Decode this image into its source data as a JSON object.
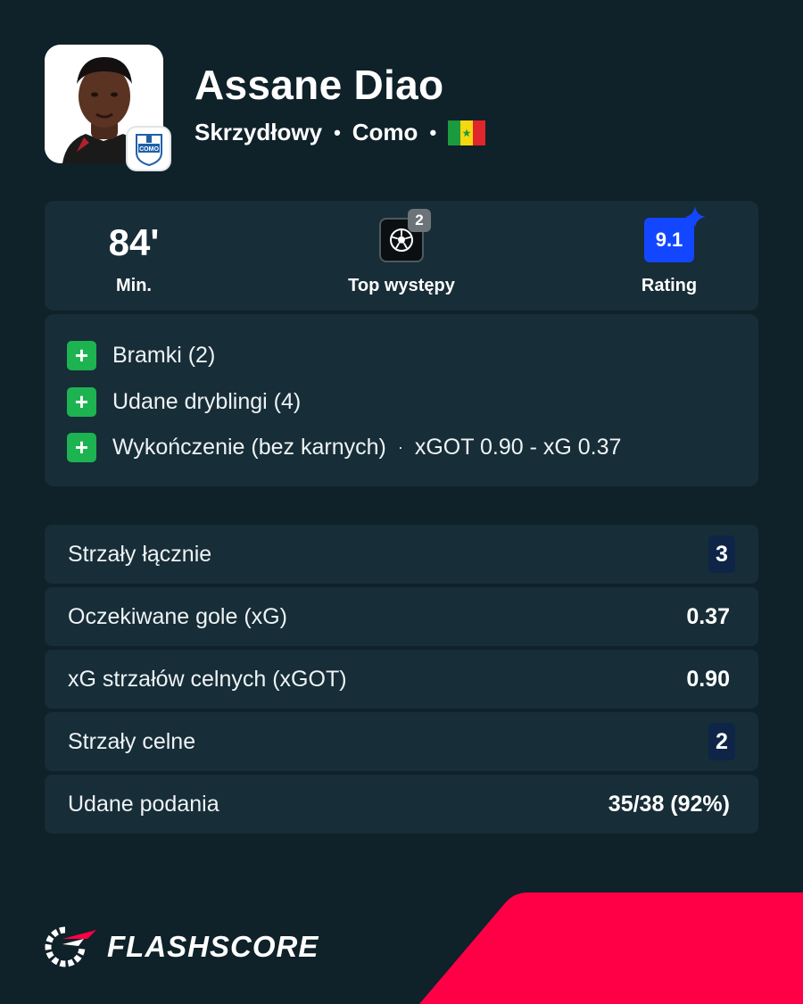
{
  "player": {
    "name": "Assane Diao",
    "position": "Skrzydłowy",
    "club": "Como",
    "club_badge_text": "COMO",
    "separator": "•"
  },
  "summary": {
    "minutes_value": "84'",
    "minutes_label": "Min.",
    "top_count": "2",
    "top_label": "Top występy",
    "rating_value": "9.1",
    "rating_label": "Rating"
  },
  "strengths": [
    {
      "icon": "+",
      "label": "Bramki (2)"
    },
    {
      "icon": "+",
      "label": "Udane dryblingi (4)"
    },
    {
      "icon": "+",
      "label": "Wykończenie (bez karnych)",
      "separator": "·",
      "detail": "xGOT 0.90 - xG 0.37"
    }
  ],
  "stats": [
    {
      "label": "Strzały łącznie",
      "value": "3"
    },
    {
      "label": "Oczekiwane gole (xG)",
      "value": "0.37"
    },
    {
      "label": "xG strzałów celnych (xGOT)",
      "value": "0.90"
    },
    {
      "label": "Strzały celne",
      "value": "2"
    },
    {
      "label": "Udane podania",
      "value": "35/38 (92%)"
    }
  ],
  "footer": {
    "brand": "FLASHSCORE"
  },
  "colors": {
    "background": "#0f2129",
    "card": "#172d37",
    "plus_green": "#1db351",
    "rating_blue": "#1347ff",
    "brand_red": "#ff0046"
  },
  "icons": [
    "player-photo",
    "club-badge-icon",
    "senegal-flag-icon",
    "football-icon",
    "star-icon",
    "plus-icon",
    "flashscore-logo-icon"
  ]
}
